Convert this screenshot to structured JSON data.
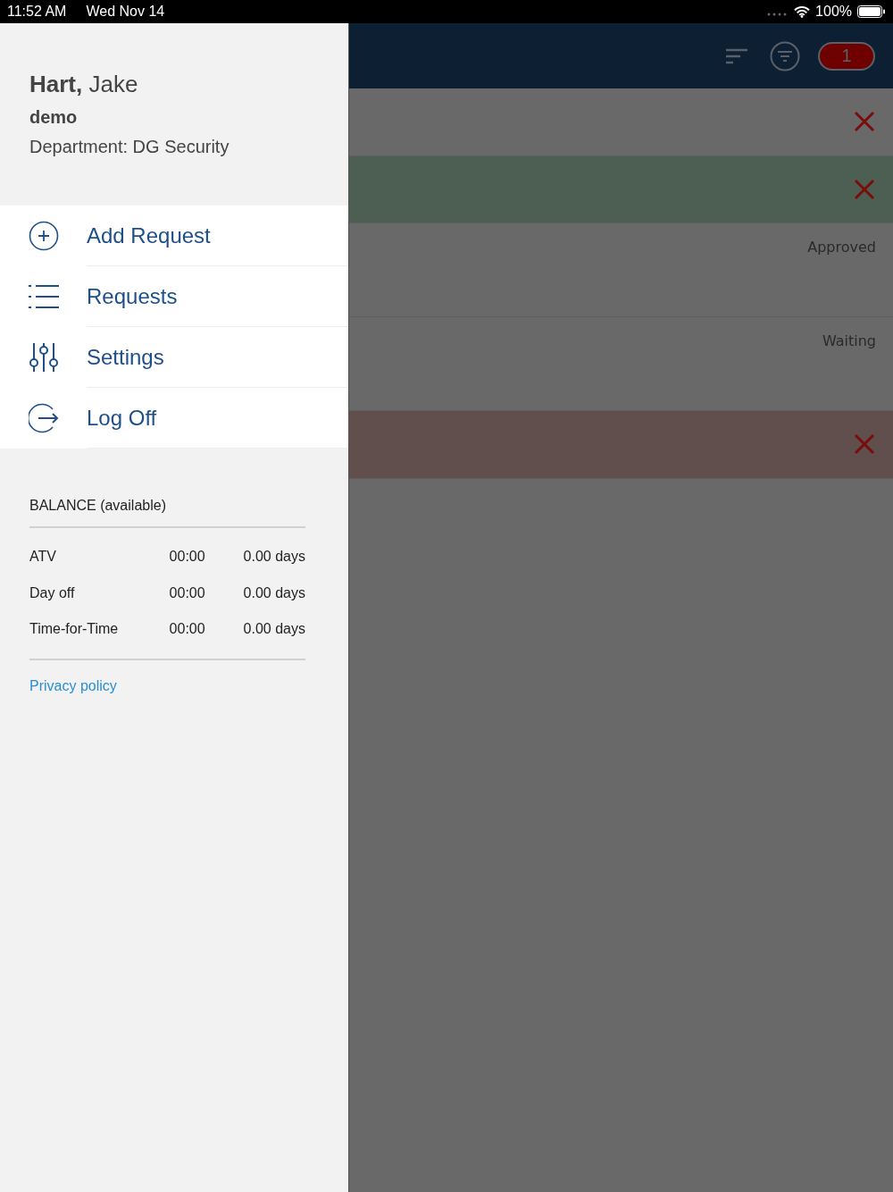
{
  "status_bar": {
    "time": "11:52 AM",
    "date": "Wed Nov 14",
    "battery": "100%"
  },
  "header": {
    "badge": "1"
  },
  "rows": [
    {
      "kind": "cancel",
      "color": "#696969"
    },
    {
      "kind": "cancel",
      "color": "#4d5e52"
    },
    {
      "kind": "status",
      "color": "#696969",
      "status": "Approved"
    },
    {
      "kind": "status",
      "color": "#696969",
      "status": "Waiting"
    },
    {
      "kind": "cancel",
      "color": "#614f4e"
    }
  ],
  "drawer": {
    "user": "**Hart,** Jake",
    "account": "demo",
    "department": "Department: DG Security",
    "menu": [
      {
        "kind": "add",
        "label": "Add Request"
      },
      {
        "kind": "list",
        "label": "Requests"
      },
      {
        "kind": "sliders",
        "label": "Settings"
      },
      {
        "kind": "logout",
        "label": "Log Off"
      }
    ],
    "balance": {
      "title": "BALANCE (available)",
      "rows": [
        {
          "type": "ATV",
          "hours": "00:00",
          "days": "0.00 days"
        },
        {
          "type": "Day off",
          "hours": "00:00",
          "days": "0.00 days"
        },
        {
          "type": "Time-for-Time",
          "hours": "00:00",
          "days": "0.00 days"
        }
      ]
    },
    "privacy_link": "Privacy policy"
  }
}
